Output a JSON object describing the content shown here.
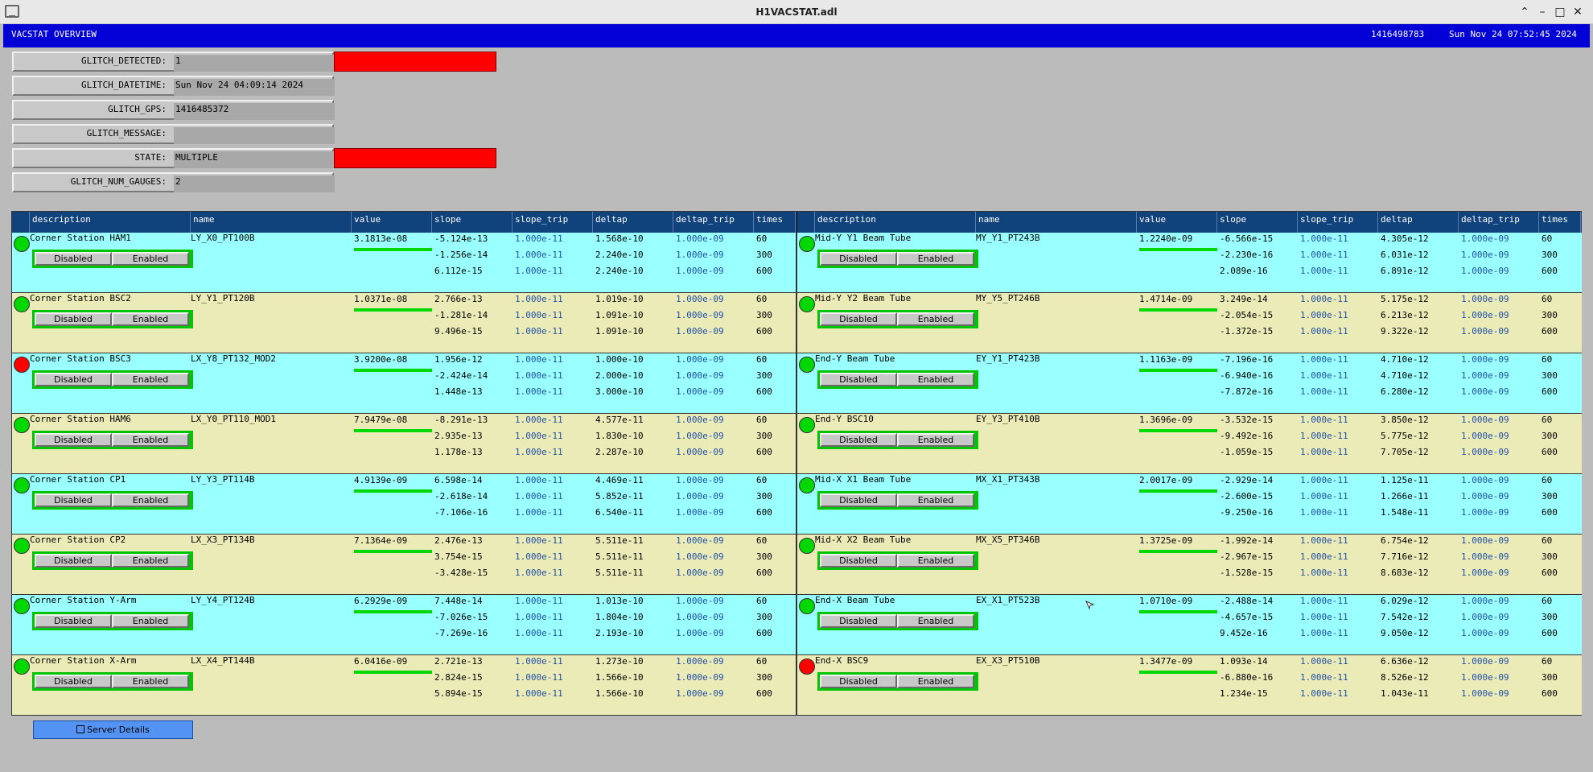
{
  "window": {
    "title": "H1VACSTAT.adl"
  },
  "banner": {
    "title": "VACSTAT OVERVIEW",
    "gps": "1416498783",
    "datetime": "Sun Nov 24 07:52:45 2024"
  },
  "glitch": [
    {
      "label": "GLITCH_DETECTED:",
      "value": "1",
      "alarm": true
    },
    {
      "label": "GLITCH_DATETIME:",
      "value": "Sun Nov 24 04:09:14 2024",
      "alarm": false
    },
    {
      "label": "GLITCH_GPS:",
      "value": "1416485372",
      "alarm": false
    },
    {
      "label": "GLITCH_MESSAGE:",
      "value": "",
      "alarm": false
    },
    {
      "label": "STATE:",
      "value": "MULTIPLE",
      "alarm": true
    },
    {
      "label": "GLITCH_NUM_GAUGES:",
      "value": "2",
      "alarm": false
    }
  ],
  "headers": [
    "description",
    "name",
    "value",
    "slope",
    "slope_trip",
    "deltap",
    "deltap_trip",
    "times"
  ],
  "toggle": {
    "disabled": "Disabled",
    "enabled": "Enabled"
  },
  "server_button": "Server Details",
  "colors": {
    "ok": "#00d800",
    "alarm": "#fe0000",
    "row_a": "#99ffff",
    "row_b": "#ebebb8",
    "header": "#10427c",
    "banner": "#0000d7"
  },
  "left": [
    {
      "status": "green",
      "desc": "Corner Station HAM1",
      "name": "LY_X0_PT100B",
      "value": "3.1813e-08",
      "slope": [
        "-5.124e-13",
        "-1.256e-14",
        "6.112e-15"
      ],
      "deltap": [
        "1.568e-10",
        "2.240e-10",
        "2.240e-10"
      ]
    },
    {
      "status": "green",
      "desc": "Corner Station BSC2",
      "name": "LY_Y1_PT120B",
      "value": "1.0371e-08",
      "slope": [
        "2.766e-13",
        "-1.281e-14",
        "9.496e-15"
      ],
      "deltap": [
        "1.019e-10",
        "1.091e-10",
        "1.091e-10"
      ]
    },
    {
      "status": "red",
      "desc": "Corner Station BSC3",
      "name": "LX_Y8_PT132_MOD2",
      "value": "3.9200e-08",
      "slope": [
        "1.956e-12",
        "-2.424e-14",
        "1.448e-13"
      ],
      "deltap": [
        "1.000e-10",
        "2.000e-10",
        "3.000e-10"
      ]
    },
    {
      "status": "green",
      "desc": "Corner Station HAM6",
      "name": "LX_Y0_PT110_MOD1",
      "value": "7.9479e-08",
      "slope": [
        "-8.291e-13",
        "2.935e-13",
        "1.178e-13"
      ],
      "deltap": [
        "4.577e-11",
        "1.830e-10",
        "2.287e-10"
      ]
    },
    {
      "status": "green",
      "desc": "Corner Station CP1",
      "name": "LY_Y3_PT114B",
      "value": "4.9139e-09",
      "slope": [
        "6.598e-14",
        "-2.618e-14",
        "-7.106e-16"
      ],
      "deltap": [
        "4.469e-11",
        "5.852e-11",
        "6.540e-11"
      ]
    },
    {
      "status": "green",
      "desc": "Corner Station CP2",
      "name": "LX_X3_PT134B",
      "value": "7.1364e-09",
      "slope": [
        "2.476e-13",
        "3.754e-15",
        "-3.428e-15"
      ],
      "deltap": [
        "5.511e-11",
        "5.511e-11",
        "5.511e-11"
      ]
    },
    {
      "status": "green",
      "desc": "Corner Station Y-Arm",
      "name": "LY_Y4_PT124B",
      "value": "6.2929e-09",
      "slope": [
        "7.448e-14",
        "-7.026e-15",
        "-7.269e-16"
      ],
      "deltap": [
        "1.013e-10",
        "1.804e-10",
        "2.193e-10"
      ]
    },
    {
      "status": "green",
      "desc": "Corner Station X-Arm",
      "name": "LX_X4_PT144B",
      "value": "6.0416e-09",
      "slope": [
        "2.721e-13",
        "2.824e-15",
        "5.894e-15"
      ],
      "deltap": [
        "1.273e-10",
        "1.566e-10",
        "1.566e-10"
      ]
    }
  ],
  "right": [
    {
      "status": "green",
      "desc": "Mid-Y Y1 Beam Tube",
      "name": "MY_Y1_PT243B",
      "value": "1.2240e-09",
      "slope": [
        "-6.566e-15",
        "-2.230e-16",
        "2.089e-16"
      ],
      "deltap": [
        "4.305e-12",
        "6.031e-12",
        "6.891e-12"
      ]
    },
    {
      "status": "green",
      "desc": "Mid-Y Y2 Beam Tube",
      "name": "MY_Y5_PT246B",
      "value": "1.4714e-09",
      "slope": [
        "3.249e-14",
        "-2.054e-15",
        "-1.372e-15"
      ],
      "deltap": [
        "5.175e-12",
        "6.213e-12",
        "9.322e-12"
      ]
    },
    {
      "status": "green",
      "desc": "End-Y Beam Tube",
      "name": "EY_Y1_PT423B",
      "value": "1.1163e-09",
      "slope": [
        "-7.196e-16",
        "-6.940e-16",
        "-7.872e-16"
      ],
      "deltap": [
        "4.710e-12",
        "4.710e-12",
        "6.280e-12"
      ]
    },
    {
      "status": "green",
      "desc": "End-Y BSC10",
      "name": "EY_Y3_PT410B",
      "value": "1.3696e-09",
      "slope": [
        "-3.532e-15",
        "-9.492e-16",
        "-1.059e-15"
      ],
      "deltap": [
        "3.850e-12",
        "5.775e-12",
        "7.705e-12"
      ]
    },
    {
      "status": "green",
      "desc": "Mid-X X1 Beam Tube",
      "name": "MX_X1_PT343B",
      "value": "2.0017e-09",
      "slope": [
        "-2.929e-14",
        "-2.600e-15",
        "-9.250e-16"
      ],
      "deltap": [
        "1.125e-11",
        "1.266e-11",
        "1.548e-11"
      ]
    },
    {
      "status": "green",
      "desc": "Mid-X X2 Beam Tube",
      "name": "MX_X5_PT346B",
      "value": "1.3725e-09",
      "slope": [
        "-1.992e-14",
        "-2.967e-15",
        "-1.528e-15"
      ],
      "deltap": [
        "6.754e-12",
        "7.716e-12",
        "8.683e-12"
      ]
    },
    {
      "status": "green",
      "desc": "End-X Beam Tube",
      "name": "EX_X1_PT523B",
      "value": "1.0710e-09",
      "slope": [
        "-2.488e-14",
        "-4.657e-15",
        "9.452e-16"
      ],
      "deltap": [
        "6.029e-12",
        "7.542e-12",
        "9.050e-12"
      ]
    },
    {
      "status": "red",
      "desc": "End-X BSC9",
      "name": "EX_X3_PT510B",
      "value": "1.3477e-09",
      "slope": [
        "1.093e-14",
        "-6.880e-16",
        "1.234e-15"
      ],
      "deltap": [
        "6.636e-12",
        "8.526e-12",
        "1.043e-11"
      ]
    }
  ],
  "slope_trip": "1.000e-11",
  "deltap_trip": "1.000e-09",
  "times": [
    "60",
    "300",
    "600"
  ]
}
